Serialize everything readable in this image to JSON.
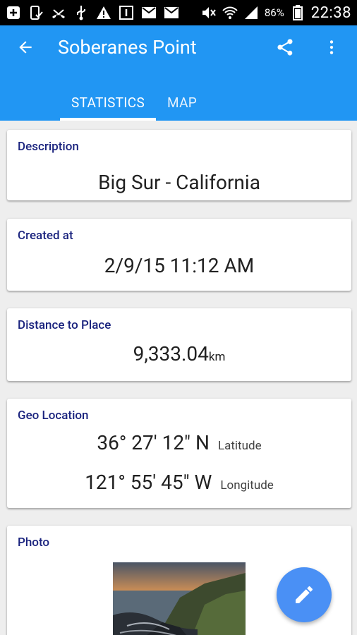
{
  "status_bar": {
    "icons_left": [
      "plus-box-icon",
      "phone-check-icon",
      "missed-call-icon",
      "usb-icon",
      "warning-icon",
      "one-box-icon",
      "gmail-icon",
      "gmail-icon-2"
    ],
    "icons_right": [
      "mute-icon",
      "wifi-icon",
      "signal-icon"
    ],
    "battery_text": "86%",
    "time": "22:38"
  },
  "appbar": {
    "title": "Soberanes Point",
    "color": "#2196F3"
  },
  "tabs": [
    {
      "label": "STATISTICS",
      "active": true
    },
    {
      "label": "MAP",
      "active": false
    }
  ],
  "cards": {
    "description": {
      "label": "Description",
      "value": "Big Sur - California"
    },
    "created": {
      "label": "Created at",
      "value": "2/9/15 11:12 AM"
    },
    "distance": {
      "label": "Distance to Place",
      "value": "9,333.04",
      "unit": "km"
    },
    "geo": {
      "label": "Geo Location",
      "lat_value": "36° 27' 12\" N",
      "lat_label": "Latitude",
      "lon_value": "121° 55' 45\" W",
      "lon_label": "Longitude"
    },
    "photo": {
      "label": "Photo"
    }
  }
}
